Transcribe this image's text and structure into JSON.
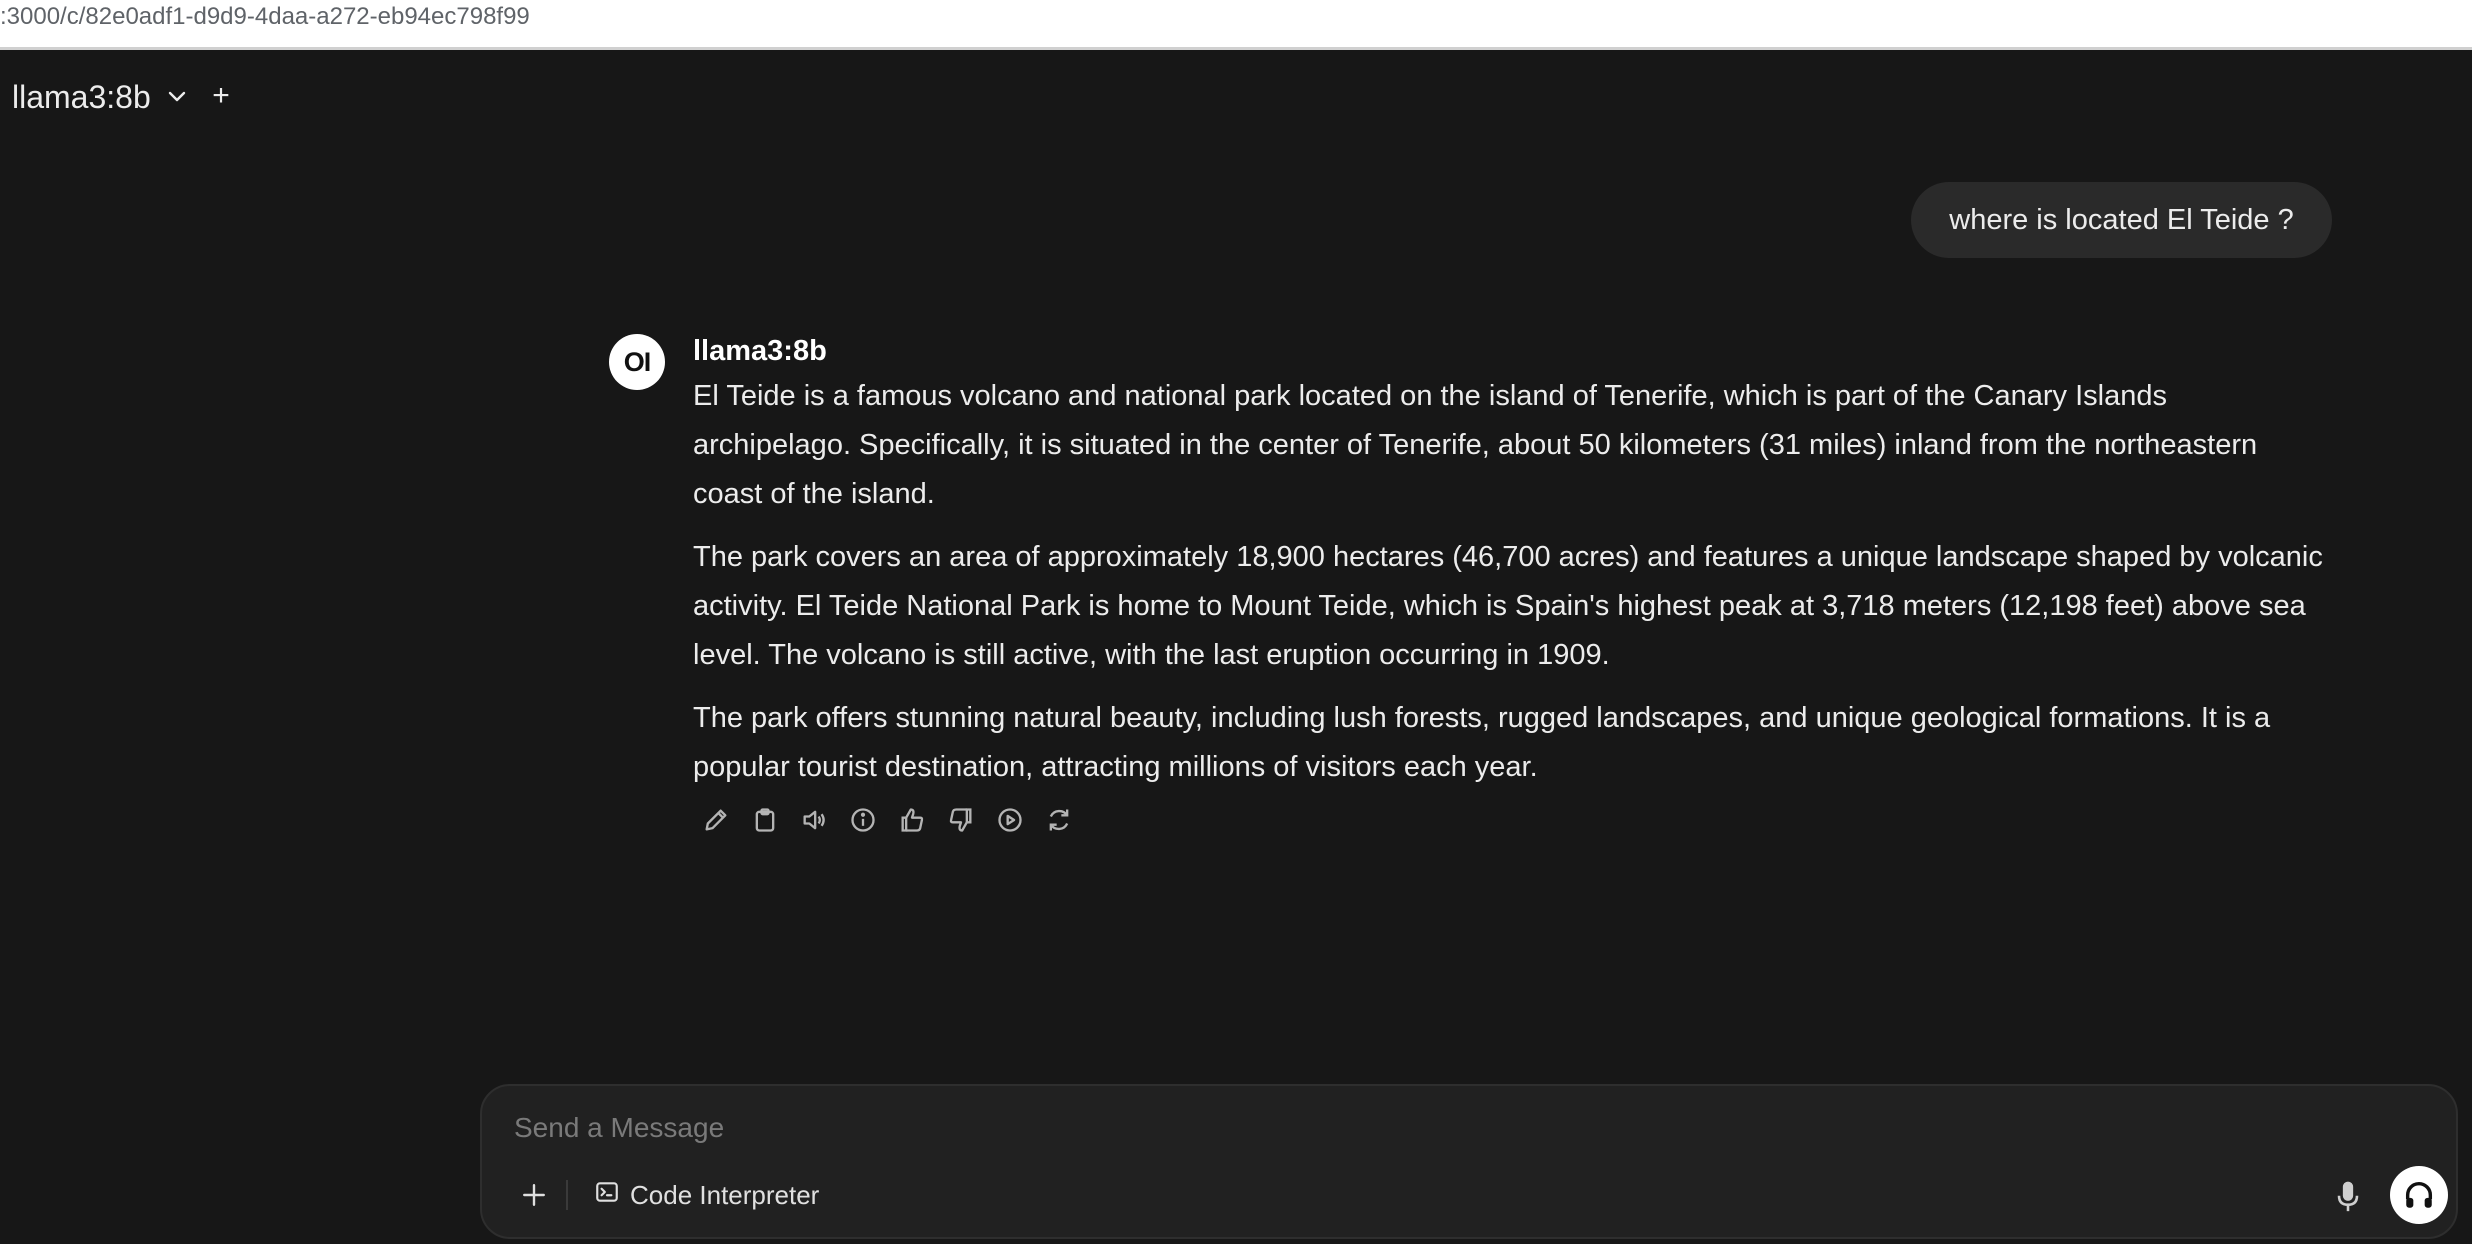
{
  "browser": {
    "url": ":3000/c/82e0adf1-d9d9-4daa-a272-eb94ec798f99"
  },
  "header": {
    "model_name": "llama3:8b",
    "new_tab_label": "+"
  },
  "conversation": {
    "user_message": "where is located El Teide ?",
    "assistant": {
      "avatar_text": "OI",
      "name": "llama3:8b",
      "paragraphs": [
        "El Teide is a famous volcano and national park located on the island of Tenerife, which is part of the Canary Islands archipelago. Specifically, it is situated in the center of Tenerife, about 50 kilometers (31 miles) inland from the northeastern coast of the island.",
        "The park covers an area of approximately 18,900 hectares (46,700 acres) and features a unique landscape shaped by volcanic activity. El Teide National Park is home to Mount Teide, which is Spain's highest peak at 3,718 meters (12,198 feet) above sea level. The volcano is still active, with the last eruption occurring in 1909.",
        "The park offers stunning natural beauty, including lush forests, rugged landscapes, and unique geological formations. It is a popular tourist destination, attracting millions of visitors each year."
      ],
      "action_icons": [
        "edit-icon",
        "copy-icon",
        "read-aloud-icon",
        "info-icon",
        "thumbs-up-icon",
        "thumbs-down-icon",
        "continue-icon",
        "regenerate-icon"
      ]
    }
  },
  "composer": {
    "placeholder": "Send a Message",
    "code_interpreter_label": "Code Interpreter"
  },
  "colors": {
    "background": "#171717",
    "bubble": "#2a2a2a",
    "composer": "#212121",
    "text": "#ececec"
  }
}
